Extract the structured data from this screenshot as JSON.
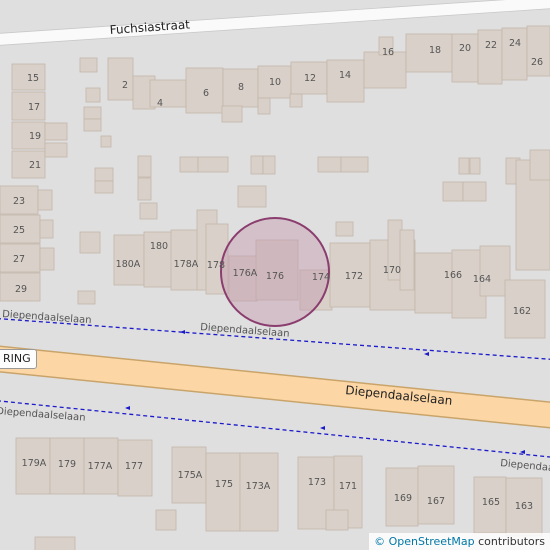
{
  "map": {
    "streets": {
      "north": "Fuchsiastraat",
      "south_main": "Diependaalselaan",
      "path_north": "Diependaalselaan",
      "path_south_left": "Diependaalselaan",
      "path_south_right": "Diependaalselaan"
    },
    "route_badge": "RING",
    "house_numbers": {
      "n1": "15",
      "n2": "17",
      "n3": "19",
      "n4": "21",
      "n5": "23",
      "n6": "25",
      "n7": "27",
      "n8": "29",
      "n9": "2",
      "n10": "4",
      "n11": "6",
      "n12": "8",
      "n13": "10",
      "n14": "12",
      "n15": "14",
      "n16": "16",
      "n17": "18",
      "n18": "20",
      "n19": "22",
      "n20": "24",
      "n21": "26",
      "n22": "180A",
      "n23": "180",
      "n24": "178A",
      "n25": "178",
      "n26": "176A",
      "n27": "176",
      "n28": "174",
      "n29": "172",
      "n30": "170",
      "n31": "166",
      "n32": "164",
      "n33": "162",
      "n34": "179A",
      "n35": "179",
      "n36": "177A",
      "n37": "177",
      "n38": "175A",
      "n39": "175",
      "n40": "173A",
      "n41": "173",
      "n42": "171",
      "n43": "169",
      "n44": "167",
      "n45": "165",
      "n46": "163"
    },
    "colors": {
      "background": "#e0dfdf",
      "building": "#d9d0c9",
      "building_stroke": "#c4b6ab",
      "main_road": "#fcd6a4",
      "main_road_casing": "#c9a46a",
      "path": "#1a1acc",
      "highlight_fill": "#c39bb0",
      "highlight_stroke": "#8a3d6e"
    },
    "attribution": {
      "symbol": "©",
      "link": "OpenStreetMap",
      "suffix": " contributors"
    }
  }
}
